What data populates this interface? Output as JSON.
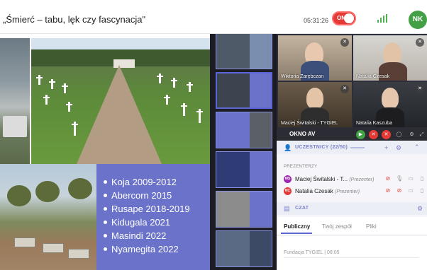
{
  "header": {
    "title": "„Śmierć – tabu, lęk czy fascynacja\"",
    "timer": "05:31:26",
    "record_label": "ON",
    "user_initials": "NK"
  },
  "slide": {
    "places": [
      "Koja 2009-2012",
      "Abercorn 2015",
      "Rusape 2018-2019",
      "Kidugala 2021",
      "Masindi 2022",
      "Nyamegita 2022"
    ]
  },
  "videos": [
    {
      "name": "Wiktoria Zarębczan",
      "mic_icon": "mic-muted-icon"
    },
    {
      "name": "Natalia Czesak",
      "mic_icon": "mic-muted-icon"
    },
    {
      "name": "Maciej Świtalski - TYGIEL",
      "mic_icon": "mic-muted-icon"
    },
    {
      "name": "Natalia Kaszuba",
      "mic_icon": "mic-muted-icon"
    }
  ],
  "av_bar": {
    "label": "OKNO AV"
  },
  "participants": {
    "label": "UCZESTNICY (22/50)",
    "presenters_label": "PREZENTERZY",
    "presenters": [
      {
        "initials": "MS",
        "name": "Maciej Świtalski - T...",
        "role": "(Prezenter)",
        "color": "#9c27b0"
      },
      {
        "initials": "NC",
        "name": "Natalia Czesak",
        "role": "(Prezenter)",
        "color": "#e53935"
      }
    ]
  },
  "chat": {
    "label": "CZAT",
    "tabs": [
      "Publiczny",
      "Twój zespół",
      "Pliki"
    ],
    "active_tab": "Publiczny",
    "last_message_meta": "Fundacja TYGIEL | 08:05"
  },
  "colors": {
    "accent": "#5d66d6",
    "slide_box": "#6a72c9",
    "record": "#e53935",
    "avatar": "#43a047",
    "video_bg": "#2e2e3a",
    "thumb_bg": "#1c1c24"
  }
}
